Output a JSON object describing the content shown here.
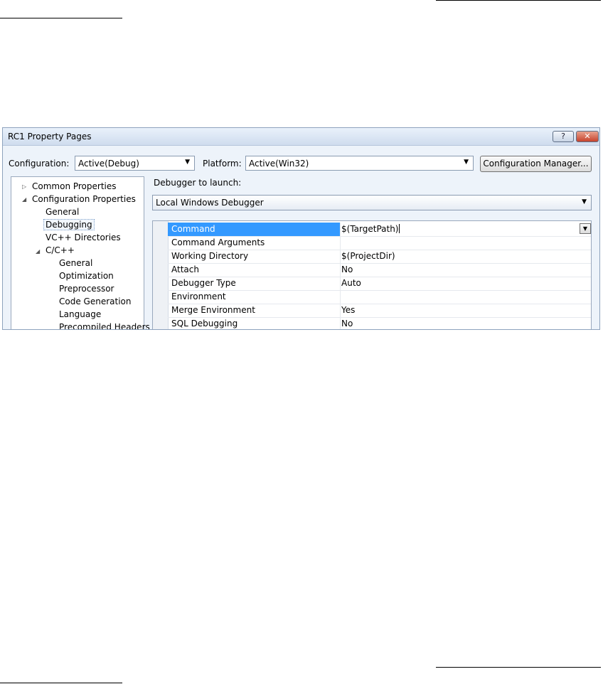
{
  "window": {
    "title": "RC1 Property Pages"
  },
  "toolbar": {
    "configuration_label": "Configuration:",
    "configuration_value": "Active(Debug)",
    "platform_label": "Platform:",
    "platform_value": "Active(Win32)",
    "config_manager_label": "Configuration Manager..."
  },
  "tree": {
    "common_properties": "Common Properties",
    "configuration_properties": "Configuration Properties",
    "general": "General",
    "debugging": "Debugging",
    "vc_directories": "VC++ Directories",
    "cpp": "C/C++",
    "cpp_children": [
      "General",
      "Optimization",
      "Preprocessor",
      "Code Generation",
      "Language",
      "Precompiled Headers"
    ]
  },
  "debugger": {
    "launch_label": "Debugger to launch:",
    "selected": "Local Windows Debugger"
  },
  "properties": [
    {
      "name": "Command",
      "value": "$(TargetPath)"
    },
    {
      "name": "Command Arguments",
      "value": ""
    },
    {
      "name": "Working Directory",
      "value": "$(ProjectDir)"
    },
    {
      "name": "Attach",
      "value": "No"
    },
    {
      "name": "Debugger Type",
      "value": "Auto"
    },
    {
      "name": "Environment",
      "value": ""
    },
    {
      "name": "Merge Environment",
      "value": "Yes"
    },
    {
      "name": "SQL Debugging",
      "value": "No"
    }
  ],
  "icons": {
    "help": "help-icon",
    "close": "close-icon",
    "dropdown": "chevron-down-icon"
  }
}
